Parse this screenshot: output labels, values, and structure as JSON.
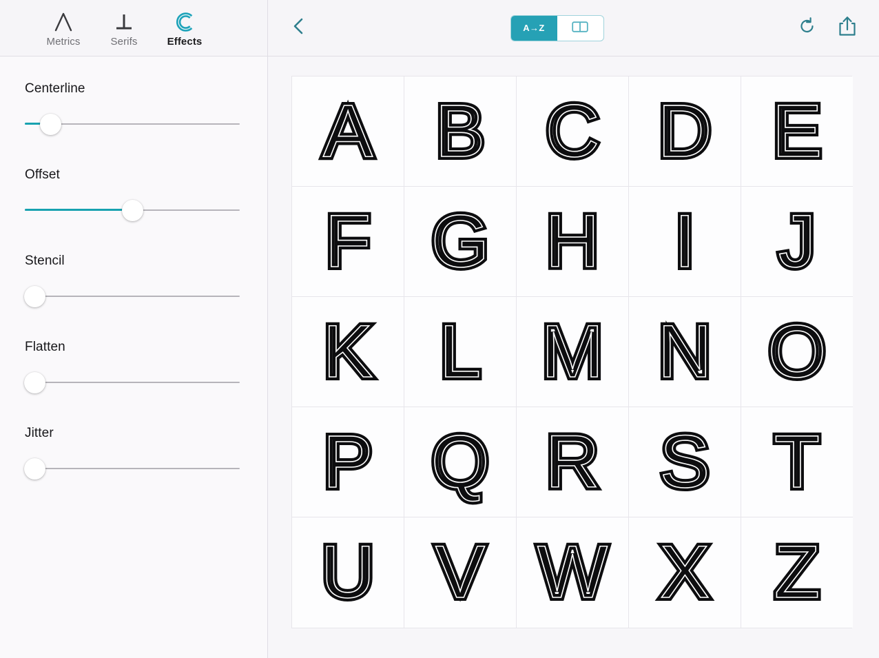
{
  "theme": {
    "accent": "#26a1b5",
    "accent_slider": "#17a2b0",
    "panel_bg": "#faf9fb",
    "page_bg": "#f7f6f9",
    "glyph_color": "#0d0d0f",
    "muted_text": "#6f6f74"
  },
  "sidebar": {
    "tabs": [
      {
        "label": "Metrics",
        "icon": "letter-a-icon",
        "active": false
      },
      {
        "label": "Serifs",
        "icon": "serif-base-icon",
        "active": false
      },
      {
        "label": "Effects",
        "icon": "letter-c-inline-icon",
        "active": true
      }
    ],
    "sliders": [
      {
        "label": "Centerline",
        "value": 12,
        "min": 0,
        "max": 100
      },
      {
        "label": "Offset",
        "value": 50,
        "min": 0,
        "max": 100
      },
      {
        "label": "Stencil",
        "value": 0,
        "min": 0,
        "max": 100
      },
      {
        "label": "Flatten",
        "value": 0,
        "min": 0,
        "max": 100
      },
      {
        "label": "Jitter",
        "value": 0,
        "min": 0,
        "max": 100
      }
    ]
  },
  "topbar": {
    "back_icon": "chevron-left-icon",
    "view_modes": [
      {
        "label": "A→Z",
        "icon": "alphabetical-order-icon",
        "active": true
      },
      {
        "label": "",
        "icon": "two-pane-view-icon",
        "active": false
      }
    ],
    "actions": [
      {
        "label": "Refresh",
        "icon": "refresh-icon"
      },
      {
        "label": "Share",
        "icon": "share-icon"
      }
    ]
  },
  "glyph_grid": {
    "columns": 5,
    "rows": 5,
    "letters": [
      "A",
      "B",
      "C",
      "D",
      "E",
      "F",
      "G",
      "H",
      "I",
      "J",
      "K",
      "L",
      "M",
      "N",
      "O",
      "P",
      "Q",
      "R",
      "S",
      "T",
      "U",
      "V",
      "W",
      "X",
      "Z"
    ]
  }
}
